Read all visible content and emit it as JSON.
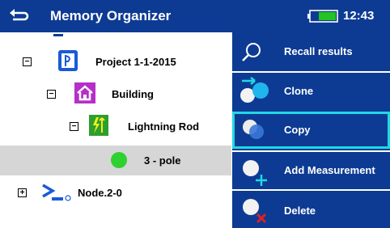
{
  "header": {
    "title": "Memory Organizer",
    "time": "12:43",
    "battery_icon": "battery-icon",
    "back_icon": "back-arrow-icon"
  },
  "tree": {
    "project": {
      "label": "Project 1-1-2015",
      "expander": "−",
      "icon": "project-icon"
    },
    "building": {
      "label": "Building",
      "expander": "−",
      "icon": "house-icon"
    },
    "lightning": {
      "label": "Lightning Rod",
      "expander": "−",
      "icon": "lightning-rod-icon"
    },
    "measurement": {
      "label": "3 - pole",
      "icon": "green-status-dot-icon"
    },
    "node": {
      "label": "Node.2-0",
      "expander": "+",
      "icon": "node-icon"
    }
  },
  "actions": [
    {
      "label": "Recall results",
      "icon": "search-icon"
    },
    {
      "label": "Clone",
      "icon": "clone-icon"
    },
    {
      "label": "Copy",
      "icon": "copy-icon"
    },
    {
      "label": "Add Measurement",
      "icon": "add-measurement-icon"
    },
    {
      "label": "Delete",
      "icon": "delete-icon"
    }
  ],
  "colors": {
    "header_bg": "#0d3b93",
    "panel_bg": "#0d3b93",
    "active_border": "#20d8e4",
    "selected_row": "#d6d6d6",
    "status_green": "#2fd12f",
    "battery_green": "#22c322"
  }
}
